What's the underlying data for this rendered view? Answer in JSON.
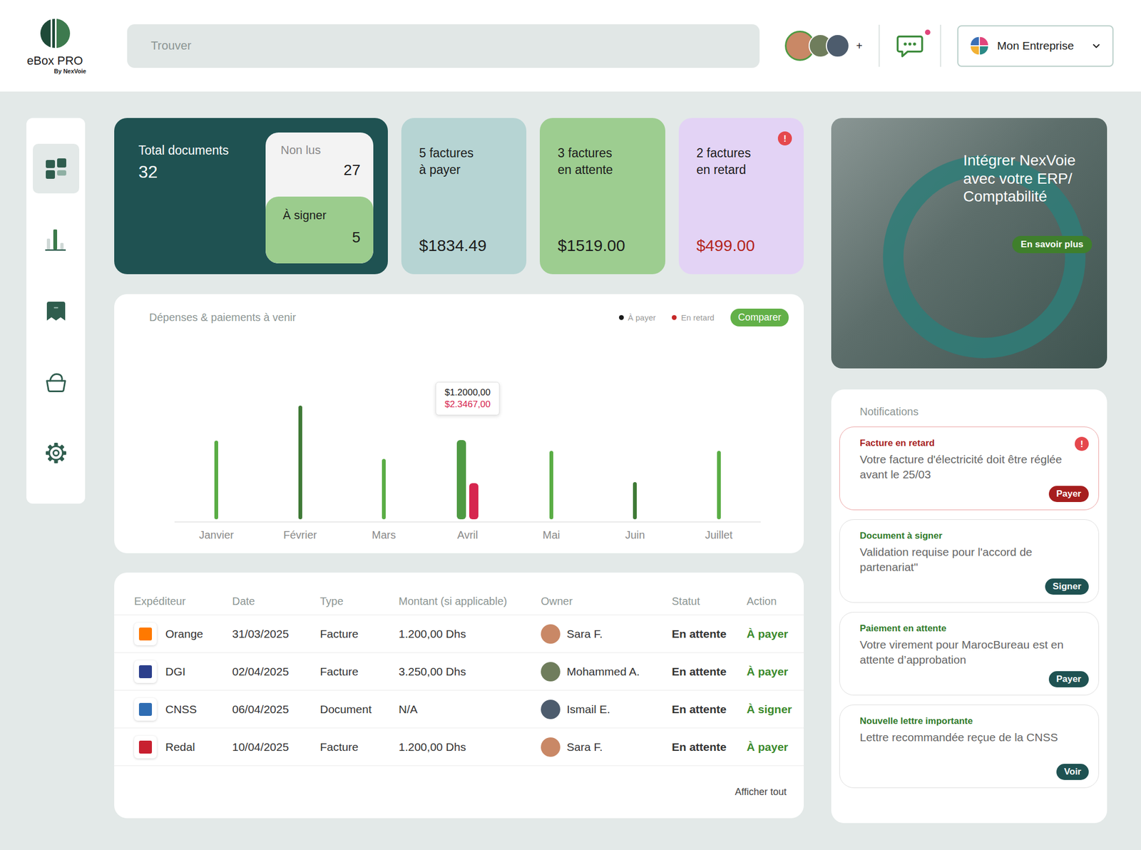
{
  "brand": {
    "name": "eBox PRO",
    "tagline": "By NexVoie"
  },
  "search": {
    "placeholder": "Trouver"
  },
  "team": {
    "avatars": [
      {
        "color": "#c98866"
      },
      {
        "color": "#6f7d5c"
      },
      {
        "color": "#4d5c6d"
      }
    ],
    "more": "+"
  },
  "messages": {
    "unread": true
  },
  "company": {
    "name": "Mon Entreprise"
  },
  "icons": {
    "alert": "!"
  },
  "sidebar": {
    "items": [
      {
        "kind": "dashboard",
        "selected": true
      },
      {
        "kind": "chart",
        "selected": false
      },
      {
        "kind": "inbox",
        "selected": false
      },
      {
        "kind": "basket",
        "selected": false
      },
      {
        "kind": "settings",
        "selected": false
      }
    ]
  },
  "summary": {
    "total": {
      "label": "Total documents",
      "value": "32"
    },
    "unread": {
      "label": "Non lus",
      "value": "27"
    },
    "to_sign": {
      "label": "À signer",
      "value": "5"
    }
  },
  "cards": [
    {
      "lines": [
        "5 factures",
        "à payer"
      ],
      "amount": "$1834.49",
      "color": "#b6d4d3",
      "alert": false
    },
    {
      "lines": [
        "3 factures",
        "en attente"
      ],
      "amount": "$1519.00",
      "color": "#9dcd90",
      "alert": false
    },
    {
      "lines": [
        "2 factures",
        "en retard"
      ],
      "amount": "$499.00",
      "color": "#e3d3f5",
      "alert": true
    }
  ],
  "chart": {
    "title": "Dépenses & paiements à venir",
    "compare": "Comparer",
    "legend": [
      {
        "label": "À payer",
        "color": "#1a1a1a"
      },
      {
        "label": "En retard",
        "color": "#c62828"
      }
    ],
    "months": [
      {
        "label": "Janvier",
        "selected": false
      },
      {
        "label": "Février",
        "selected": false
      },
      {
        "label": "Mars",
        "selected": false
      },
      {
        "label": "Avril",
        "selected": true
      },
      {
        "label": "Mai",
        "selected": false
      },
      {
        "label": "Juin",
        "selected": false
      },
      {
        "label": "Juillet",
        "selected": false
      }
    ],
    "paid": {
      "values": [
        108,
        156,
        83,
        109,
        94,
        51,
        94
      ],
      "colors": [
        "#5aad45",
        "#3f7a36",
        "#5aad45",
        "#4e9a43",
        "#5aad45",
        "#3f7a36",
        "#5aad45"
      ]
    },
    "late": {
      "values": [
        0,
        0,
        0,
        50,
        0,
        0,
        0
      ],
      "color": "#d6264f"
    },
    "tooltip": [
      "$1.2000,00",
      "$2.3467,00"
    ]
  },
  "table": {
    "columns": [
      "Expéditeur",
      "Date",
      "Type",
      "Montant (si applicable)",
      "Owner",
      "Statut",
      "Action"
    ],
    "rows": [
      {
        "sender": "Orange",
        "logo_color": "#ff7900",
        "date": "31/03/2025",
        "type": "Facture",
        "amount": "1.200,00 Dhs",
        "owner": "Sara F.",
        "avatar_color": "#c98866",
        "status": "En attente",
        "action": "À payer"
      },
      {
        "sender": "DGI",
        "logo_color": "#2b3f8c",
        "date": "02/04/2025",
        "type": "Facture",
        "amount": "3.250,00 Dhs",
        "owner": "Mohammed A.",
        "avatar_color": "#6f7d5c",
        "status": "En attente",
        "action": "À payer"
      },
      {
        "sender": "CNSS",
        "logo_color": "#2f6db3",
        "date": "06/04/2025",
        "type": "Document",
        "amount": "N/A",
        "owner": "Ismail E.",
        "avatar_color": "#4d5c6d",
        "status": "En attente",
        "action": "À signer"
      },
      {
        "sender": "Redal",
        "logo_color": "#c8202f",
        "date": "10/04/2025",
        "type": "Facture",
        "amount": "1.200,00 Dhs",
        "owner": "Sara F.",
        "avatar_color": "#c98866",
        "status": "En attente",
        "action": "À payer"
      }
    ],
    "footer": "Afficher tout"
  },
  "promo": {
    "lines": [
      "Intégrer NexVoie",
      "avec votre ERP/",
      "Comptabilité"
    ],
    "button": "En savoir plus"
  },
  "notifications": {
    "title": "Notifications",
    "items": [
      {
        "title": "Facture en retard",
        "text": "Votre facture d'électricité doit être réglée avant le 25/03",
        "button": "Payer",
        "alert": true
      },
      {
        "title": "Document à signer",
        "text": "Validation requise pour l'accord de partenariat\"",
        "button": "Signer",
        "alert": false
      },
      {
        "title": "Paiement en attente",
        "text": "Votre virement pour MarocBureau est en attente d’approbation",
        "button": "Payer",
        "alert": false
      },
      {
        "title": "Nouvelle lettre importante",
        "text": "Lettre recommandée reçue de la CNSS",
        "button": "Voir",
        "alert": false
      }
    ]
  }
}
